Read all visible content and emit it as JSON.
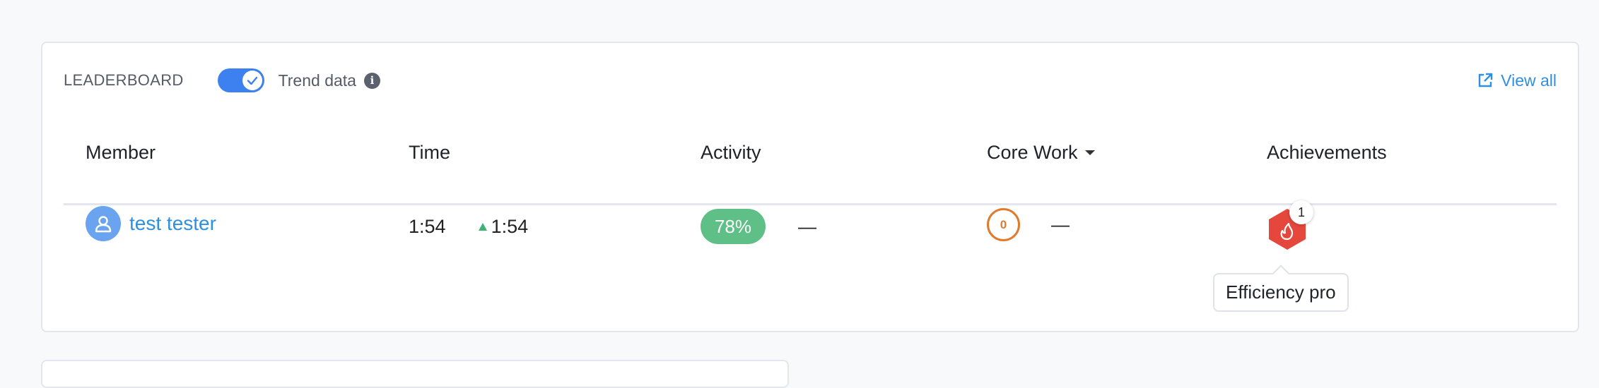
{
  "leaderboard": {
    "title": "LEADERBOARD",
    "trend_toggle": {
      "label": "Trend data",
      "on": true
    },
    "info_icon_glyph": "i",
    "view_all_label": "View all"
  },
  "columns": [
    "Member",
    "Time",
    "Activity",
    "Core Work",
    "Achievements"
  ],
  "rows": [
    {
      "member": "test tester",
      "time": "1:54",
      "time_trend": "1:54",
      "activity": "78%",
      "activity_trend": "—",
      "core_work": "0",
      "core_work_trend": "—",
      "achievement_count": "1",
      "achievement_tooltip": "Efficiency pro"
    }
  ],
  "colors": {
    "accent": "#3d80f0",
    "link": "#2f8fe0",
    "activity_pill": "#5ebf87",
    "core_work_ring": "#e07a2c",
    "achievement_badge": "#e5473d",
    "trend_up": "#3cb574"
  },
  "icons": {
    "toggle": "check-icon",
    "info": "info-icon",
    "view_all": "external-link-icon",
    "avatar": "user-icon",
    "achievement": "flame-hexagon-icon"
  }
}
